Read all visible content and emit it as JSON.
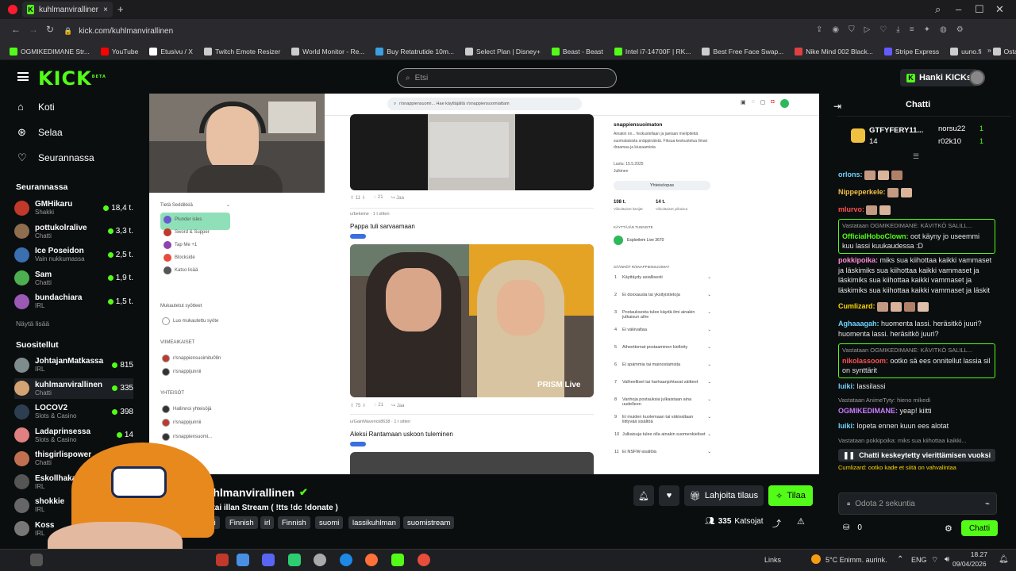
{
  "browser": {
    "tab_title": "kuhlmanvirallinen Str...",
    "url": "kick.com/kuhlmanvirallinen",
    "bookmarks": [
      {
        "label": "OGMIKEDIMANE Str...",
        "color": "#53fc18"
      },
      {
        "label": "YouTube",
        "color": "#ff0000"
      },
      {
        "label": "Etusivu / X",
        "color": "#ffffff"
      },
      {
        "label": "Twitch Emote Resizer",
        "color": "#cccccc"
      },
      {
        "label": "World Monitor - Re...",
        "color": "#cccccc"
      },
      {
        "label": "Buy Retatrutide 10m...",
        "color": "#3aa0e0"
      },
      {
        "label": "Select Plan | Disney+",
        "color": "#cccccc"
      },
      {
        "label": "Beast - Beast",
        "color": "#53fc18"
      },
      {
        "label": "Intel i7-14700F | RK...",
        "color": "#53fc18"
      },
      {
        "label": "Best Free Face Swap...",
        "color": "#cccccc"
      },
      {
        "label": "Nike Mind 002 Black...",
        "color": "#e04040"
      },
      {
        "label": "Stripe Express",
        "color": "#635bff"
      },
      {
        "label": "uuno.fi",
        "color": "#cccccc"
      },
      {
        "label": "Osta Retatrutides | T...",
        "color": "#cccccc"
      }
    ],
    "bookmarks_more": "»"
  },
  "header": {
    "logo": "KICK",
    "logo_beta": "BETA",
    "search_placeholder": "Etsi",
    "hanki_label": "Hanki KICKs"
  },
  "sidebar": {
    "nav": [
      {
        "label": "Koti",
        "icon": "home-icon"
      },
      {
        "label": "Selaa",
        "icon": "browse-icon"
      },
      {
        "label": "Seurannassa",
        "icon": "heart-icon"
      }
    ],
    "following_title": "Seurannassa",
    "following": [
      {
        "name": "GMHikaru",
        "category": "Shakki",
        "viewers": "18,4 t.",
        "color": "#c0392b"
      },
      {
        "name": "pottukolralive",
        "category": "Chatti",
        "viewers": "3,3 t.",
        "color": "#8e6e4e"
      },
      {
        "name": "Ice Poseidon",
        "category": "Vain nukkumassa",
        "viewers": "2,5 t.",
        "color": "#3a6fb0"
      },
      {
        "name": "Sam",
        "category": "Chatti",
        "viewers": "1,9 t.",
        "color": "#4caf50"
      },
      {
        "name": "bundachiara",
        "category": "IRL",
        "viewers": "1,5 t.",
        "color": "#9b59b6"
      }
    ],
    "show_more": "Näytä lisää",
    "recommended_title": "Suositellut",
    "recommended": [
      {
        "name": "JohtajanMatkassa",
        "category": "IRL",
        "viewers": "815",
        "color": "#7f8c8d"
      },
      {
        "name": "kuhlmanvirallinen",
        "category": "Chatti",
        "viewers": "335",
        "color": "#d4a373"
      },
      {
        "name": "LOCOV2",
        "category": "Slots & Casino",
        "viewers": "398",
        "color": "#2c3e50"
      },
      {
        "name": "Ladaprinsessa",
        "category": "Slots & Casino",
        "viewers": "14",
        "color": "#e08080"
      },
      {
        "name": "thisgirlispower",
        "category": "Chatti",
        "viewers": "",
        "color": "#c07050"
      },
      {
        "name": "Eskollhaka",
        "category": "IRL",
        "viewers": "",
        "color": "#555555"
      },
      {
        "name": "shokkie",
        "category": "IRL",
        "viewers": "",
        "color": "#666666"
      },
      {
        "name": "Koss",
        "category": "IRL",
        "viewers": "",
        "color": "#777777"
      }
    ]
  },
  "stream_content": {
    "left_nav_top": "Tietä Seddikkiä",
    "left_nav_items": [
      "Plunder isles",
      "Sword & Supper",
      "Tap Me +1",
      "Blockside",
      "Katso lisää"
    ],
    "left_nav_sections": [
      "Mukautetut syötteet",
      "Luo mukautettu syöte",
      "VIIMEAIKAISET",
      "r/snappiensuoimitu08n",
      "r/snappijunnii",
      "YHTEISÖT",
      "Hallinnoi yhteisöjä",
      "r/snappijunnii",
      "r/snappiensuomi..."
    ],
    "top_search": "r/snappiensuomi... Hae käyttäjältä r/snappiensuomiattam",
    "post1_stats": [
      "11",
      "21",
      "Jaa"
    ],
    "post2_author": "u/bekeine · 1 t sitten",
    "post2_title": "Pappa tuli sarvaamaan",
    "post2_overlay": "PRISM Live",
    "post2_stats": [
      "75",
      "21",
      "Jaa"
    ],
    "post3_author": "u/GainMaverick8638 · 1 t sitten",
    "post3_title": "Aleksi Rantamaan uskoon tuleminen",
    "community_name": "snappiensuoimaton",
    "community_desc": "Ainakin on... feskustellaan ja jaetaan mielipiteitä suomalaisista snäppinäistä. Fiksua keskustelua ilman draamaa ja kiusaamista",
    "community_created": "Luotu: 15.5.2025",
    "community_type": "Julkinen",
    "community_button": "Yhteisöopas",
    "stats": [
      {
        "value": "108 t.",
        "label": "Viikoittaiset kävijät"
      },
      {
        "value": "14 t.",
        "label": "Viikoittaiset julkaisut"
      }
    ],
    "mods_title": "KÄYTTÄJÄN TUNNISTE",
    "mod_name": "Esplorilem Live 3670",
    "rules_title": "SÄÄNNÖT R/SNAPPIENSUOIMAT",
    "rules": [
      "Käyttäydy asiallisesti",
      "Ei doxxausta tai yksityistietoja",
      "Postauksesta tulee käydä ilmi ainakin julkaisun aihe",
      "Ei väkivaltaa",
      "Aiheettomat postaaminen kielletty",
      "Ei spämmia tai mainostamista",
      "Valheelliset tai harhaanjohtavat väitteet",
      "Vanhoja postauksia julkaistaan aina uudelleen",
      "Ei muiden kuolemaan tai väkivaltaan liittyvää sisältöä",
      "Julkaisuja tulee olla ainakin suomenkieliset",
      "Ei NSFW-sisältöä"
    ]
  },
  "stream_info": {
    "channel": "kuhlmanvirallinen",
    "title": "rstai illan Stream ( !tts !dc !donate )",
    "tags": [
      "ti",
      "Finnish",
      "irl",
      "Finnish",
      "suomi",
      "lassikuhlman",
      "suomistream"
    ],
    "gift_label": "Lahjoita tilaus",
    "subscribe_label": "Tilaa",
    "viewers": "335",
    "viewers_label": "Katsojat"
  },
  "chat": {
    "title": "Chatti",
    "top_gifter": {
      "name": "GTFYFERY11...",
      "count": "14"
    },
    "top2": {
      "name": "norsu22",
      "count": "1"
    },
    "top3": {
      "name": "r02k10",
      "count": "1"
    },
    "messages": [
      {
        "user": "orlons:",
        "text": "",
        "color": "#6fd3ff",
        "emotes": 3
      },
      {
        "user": "Nippeperkele:",
        "text": "",
        "color": "#f0c040",
        "emotes": 2
      },
      {
        "user": "mlurvo:",
        "text": "",
        "color": "#ff5050",
        "emotes": 2
      },
      {
        "quote": "Vastataan OGMIKEDIMANE: KÄVITKÖ SALILL...",
        "user": "OfficialHoboClown:",
        "text": "oot käyny jo useemmi kuu lassi kuukaudessa :D",
        "color": "#53fc18",
        "highlight": true
      },
      {
        "user": "pokkipoika:",
        "text": "miks sua kiihottaa kaikki vammaset ja läskimiks sua kiihottaa kaikki vammaset ja läskimiks sua kiihottaa kaikki vammaset ja läskimiks sua kiihottaa kaikki vammaset ja läskit",
        "color": "#ff8ad8"
      },
      {
        "user": "Cumlizard:",
        "text": "",
        "color": "#ffd700",
        "emotes": 4
      },
      {
        "user": "Aghaaagah:",
        "text": "huomenta lassi. heräsitkö juuri? huomenta lassi. heräsitkö juuri?",
        "color": "#6fd3ff"
      },
      {
        "quote": "Vastataan OGMIKEDIMANE: KÄVITKÖ SALILL...",
        "user": "nikolassoom:",
        "text": "ootko sä ees onnitellut lassia sil on synttärit",
        "color": "#ff5050",
        "highlight": true
      },
      {
        "user": "luiki:",
        "text": "lassilassi",
        "color": "#6fd3ff"
      },
      {
        "quote": "Vastataan AnimeTyty: hieno mikedi",
        "user": "OGMIKEDIMANE:",
        "text": "yeap! kiitti",
        "color": "#c77dff"
      },
      {
        "user": "luiki:",
        "text": "lopeta ennen kuun ees alotat",
        "color": "#6fd3ff"
      },
      {
        "quote": "Vastataan pokkipoika: miks sua kiihottaa kaikki...",
        "user": "",
        "text": "",
        "color": "#9a9a9a"
      }
    ],
    "paused": "Chatti keskeytetty vierittämisen vuoksi",
    "cumlizard_last": "Cumlizard: ootko kade et siitä on vahvalintaa",
    "input_placeholder": "Odota 2 sekuntia",
    "points": "0",
    "send_label": "Chatti"
  },
  "taskbar": {
    "links_label": "Links",
    "weather": "5°C  Enimm. aurink.",
    "lang": "ENG",
    "time": "18.27",
    "date": "09/04/2026"
  }
}
